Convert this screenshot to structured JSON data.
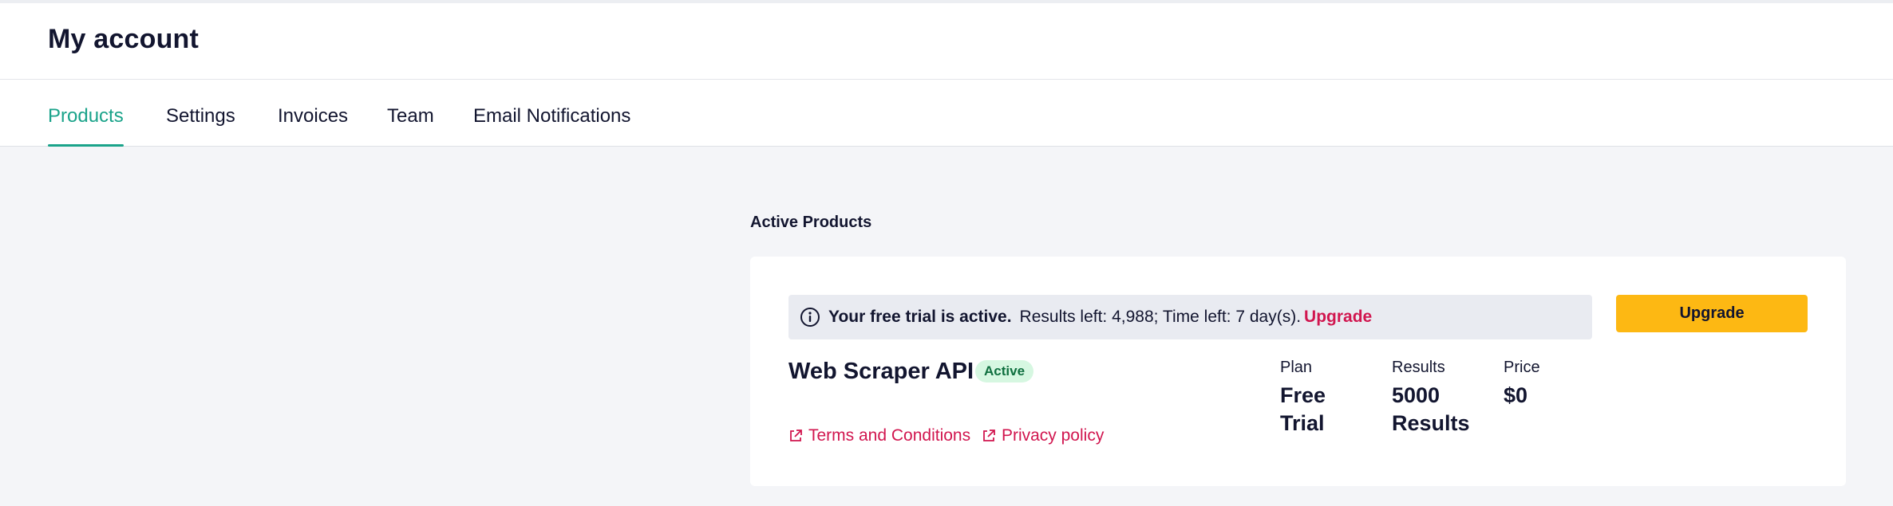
{
  "page": {
    "title": "My account"
  },
  "tabs": [
    {
      "label": "Products",
      "active": true
    },
    {
      "label": "Settings",
      "active": false
    },
    {
      "label": "Invoices",
      "active": false
    },
    {
      "label": "Team",
      "active": false
    },
    {
      "label": "Email Notifications",
      "active": false
    }
  ],
  "active_products": {
    "heading": "Active Products",
    "trial_banner": {
      "icon": "info-icon",
      "strong_text": "Your free trial is active.",
      "details": "Results left: 4,988; Time left: 7 day(s).",
      "link_label": "Upgrade"
    },
    "upgrade_button": "Upgrade",
    "product": {
      "name": "Web Scraper API",
      "status": "Active",
      "links": [
        {
          "label": "Terms and Conditions",
          "icon": "external-link-icon"
        },
        {
          "label": "Privacy policy",
          "icon": "external-link-icon"
        }
      ],
      "stats": {
        "plan": {
          "label": "Plan",
          "line1": "Free",
          "line2": "Trial"
        },
        "results": {
          "label": "Results",
          "line1": "5000",
          "line2": "Results"
        },
        "price": {
          "label": "Price",
          "value": "$0"
        }
      }
    }
  },
  "colors": {
    "accent_teal": "#1aa38a",
    "link_red": "#d1164f",
    "button_yellow": "#fdb813",
    "badge_green_bg": "#d6f7e1",
    "page_bg": "#f4f5f8"
  }
}
